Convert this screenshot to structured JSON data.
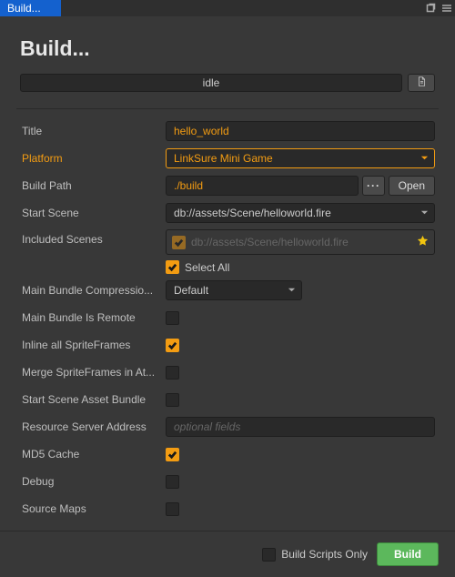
{
  "window": {
    "tab_title": "Build..."
  },
  "header": {
    "title": "Build..."
  },
  "status": {
    "text": "idle"
  },
  "form": {
    "title_label": "Title",
    "title_value": "hello_world",
    "platform_label": "Platform",
    "platform_value": "LinkSure Mini Game",
    "buildpath_label": "Build Path",
    "buildpath_value": "./build",
    "browse_label": "···",
    "open_label": "Open",
    "startscene_label": "Start Scene",
    "startscene_value": "db://assets/Scene/helloworld.fire",
    "included_label": "Included Scenes",
    "included_item": "db://assets/Scene/helloworld.fire",
    "selectall_label": "Select All",
    "compression_label": "Main Bundle Compressio...",
    "compression_value": "Default",
    "isremote_label": "Main Bundle Is Remote",
    "inline_label": "Inline all SpriteFrames",
    "merge_label": "Merge SpriteFrames in At...",
    "ssbundle_label": "Start Scene Asset Bundle",
    "resourceserver_label": "Resource Server Address",
    "resourceserver_placeholder": "optional fields",
    "md5_label": "MD5 Cache",
    "debug_label": "Debug",
    "sourcemaps_label": "Source Maps"
  },
  "footer": {
    "scriptsonly_label": "Build Scripts Only",
    "build_label": "Build"
  },
  "checks": {
    "selectall": true,
    "isremote": false,
    "inline": true,
    "merge": false,
    "ssbundle": false,
    "md5": true,
    "debug": false,
    "sourcemaps": false,
    "scriptsonly": false
  }
}
